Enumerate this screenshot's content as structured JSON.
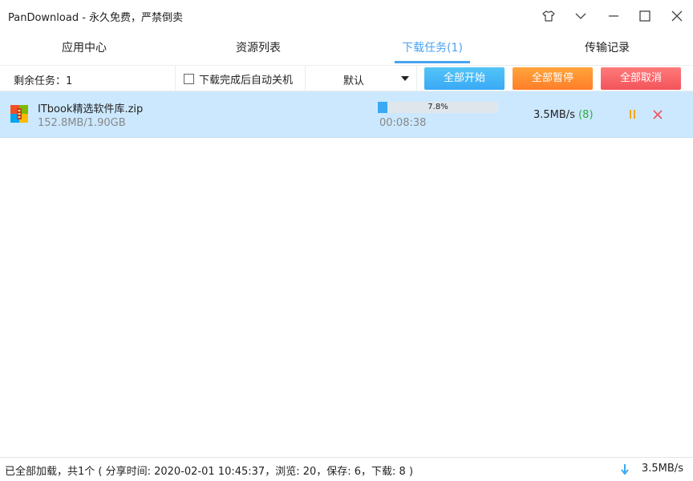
{
  "window": {
    "title": "PanDownload - 永久免费，严禁倒卖",
    "controls": [
      "shirt-icon",
      "chevron-down-icon",
      "minimize-icon",
      "maximize-icon",
      "close-icon"
    ]
  },
  "tabs": [
    {
      "label": "应用中心",
      "active": false
    },
    {
      "label": "资源列表",
      "active": false
    },
    {
      "label": "下载任务(1)",
      "active": true
    },
    {
      "label": "传输记录",
      "active": false
    }
  ],
  "toolbar": {
    "remaining_label": "剩余任务：1",
    "shutdown_label": "下载完成后自动关机",
    "shutdown_checked": false,
    "sort_value": "默认",
    "start_all": "全部开始",
    "pause_all": "全部暂停",
    "cancel_all": "全部取消",
    "colors": {
      "start": "#3aa9f5",
      "pause": "#ff8c2e",
      "cancel": "#f2545b"
    }
  },
  "task": {
    "icon": "zip-archive-icon",
    "name": "ITbook精选软件库.zip",
    "size": "152.8MB/1.90GB",
    "progress_percent": 7.8,
    "progress_label": "7.8%",
    "time_left": "00:08:38",
    "speed": "3.5MB/s",
    "connections": "(8)"
  },
  "statusbar": {
    "text": "已全部加载，共1个 ( 分享时间: 2020-02-01 10:45:37，浏览: 20，保存: 6，下载: 8 )",
    "speed": "3.5MB/s"
  },
  "colors": {
    "accent": "#4aa3f0",
    "selected_row": "#cce8ff",
    "connections": "#2cae3b"
  }
}
